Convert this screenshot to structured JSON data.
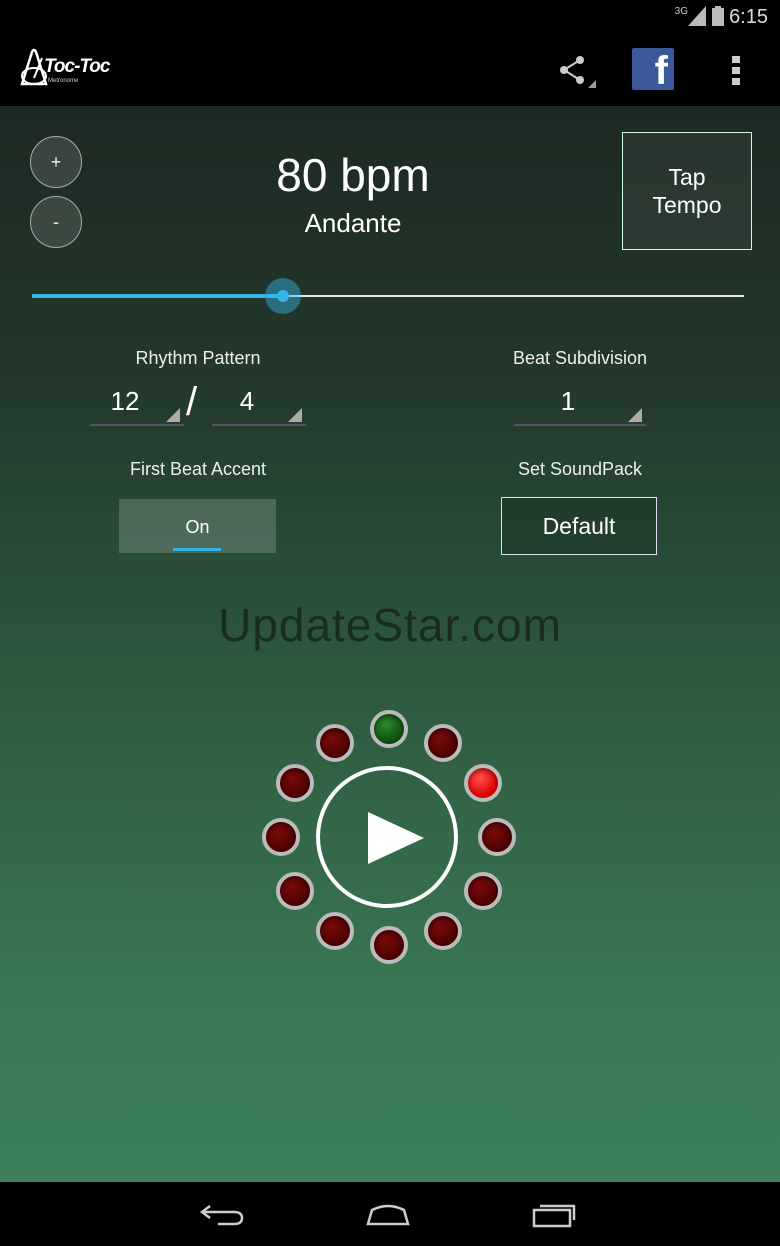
{
  "status_bar": {
    "network": "3G",
    "time": "6:15"
  },
  "app": {
    "logo_text": "Toc-Toc",
    "logo_sub": "Metronome"
  },
  "action_bar": {
    "share_icon": "share-icon",
    "facebook_letter": "f",
    "overflow_icon": "overflow-menu-icon"
  },
  "tempo": {
    "plus_label": "+",
    "minus_label": "-",
    "bpm_text": "80 bpm",
    "tempo_name": "Andante",
    "tap_label": "Tap Tempo",
    "slider_fraction": 0.35
  },
  "settings": {
    "rhythm_label": "Rhythm Pattern",
    "rhythm_numerator": "12",
    "rhythm_slash": "/",
    "rhythm_denominator": "4",
    "subdivision_label": "Beat Subdivision",
    "subdivision_value": "1",
    "accent_label": "First Beat Accent",
    "accent_value": "On",
    "soundpack_label": "Set SoundPack",
    "soundpack_value": "Default"
  },
  "watermark": "UpdateStar.com",
  "beats": {
    "count": 12,
    "states": [
      "green",
      "dark",
      "red",
      "dark",
      "dark",
      "dark",
      "dark",
      "dark",
      "dark",
      "dark",
      "dark",
      "dark"
    ]
  },
  "colors": {
    "accent": "#33b5e5",
    "beat_dark": "#4a0000",
    "beat_first": "#0d4a0d",
    "beat_active": "#e00000"
  }
}
